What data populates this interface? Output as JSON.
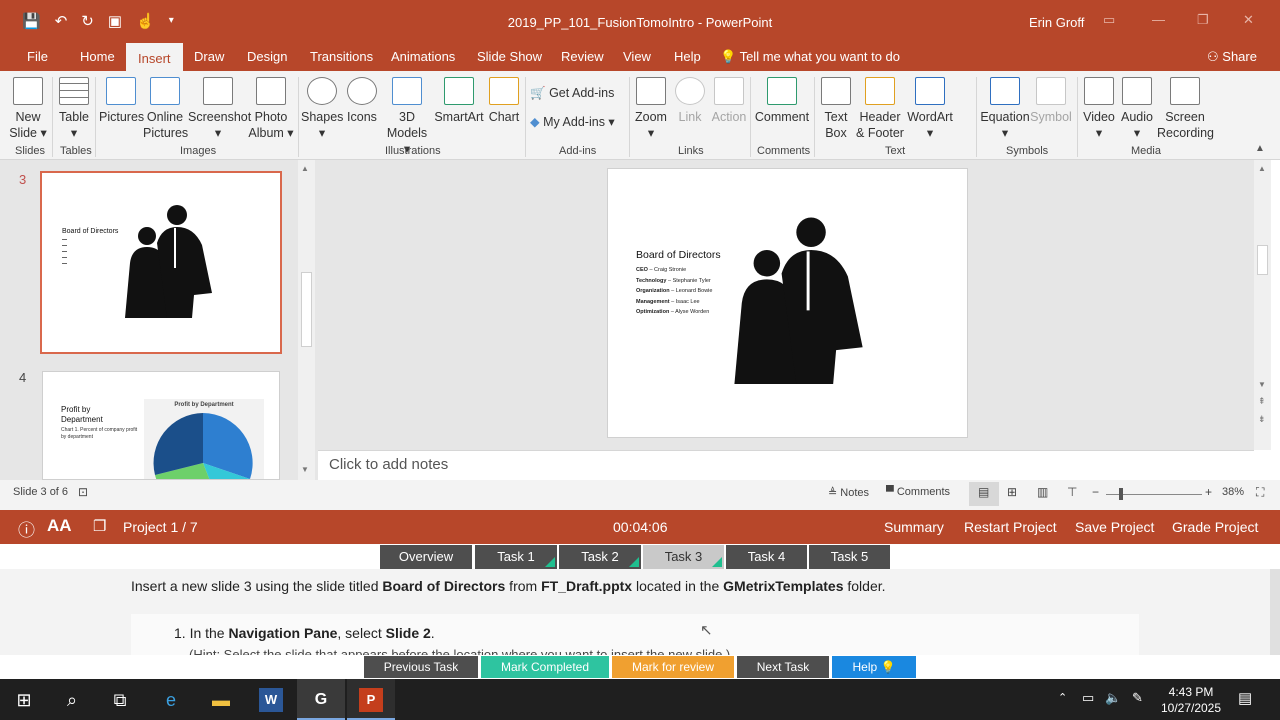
{
  "titlebar": {
    "document_title": "2019_PP_101_FusionTomoIntro - PowerPoint",
    "user": "Erin Groff",
    "qat_icons": [
      "save-icon",
      "undo-icon",
      "redo-icon",
      "present-icon",
      "touch-mode-icon",
      "customize-icon"
    ]
  },
  "tabs": [
    "File",
    "Home",
    "Insert",
    "Draw",
    "Design",
    "Transitions",
    "Animations",
    "Slide Show",
    "Review",
    "View",
    "Help"
  ],
  "active_tab": "Insert",
  "tell_me": "Tell me what you want to do",
  "share": "Share",
  "ribbon": {
    "new_slide": [
      "New",
      "Slide ▾"
    ],
    "table": [
      "Table",
      "▾"
    ],
    "pictures": "Pictures",
    "online_pictures": [
      "Online",
      "Pictures"
    ],
    "screenshot": [
      "Screenshot",
      "▾"
    ],
    "photo_album": [
      "Photo",
      "Album ▾"
    ],
    "shapes": [
      "Shapes",
      "▾"
    ],
    "icons": "Icons",
    "models": [
      "3D",
      "Models ▾"
    ],
    "smartart": "SmartArt",
    "chart": "Chart",
    "get_addins": "Get Add-ins",
    "my_addins": "My Add-ins",
    "zoom": [
      "Zoom",
      "▾"
    ],
    "link": "Link",
    "action": "Action",
    "comment": "Comment",
    "text_box": [
      "Text",
      "Box"
    ],
    "header_footer": [
      "Header",
      "& Footer"
    ],
    "wordart": [
      "WordArt",
      "▾"
    ],
    "equation": [
      "Equation",
      "▾"
    ],
    "symbol": "Symbol",
    "video": [
      "Video",
      "▾"
    ],
    "audio": [
      "Audio",
      "▾"
    ],
    "screen_recording": [
      "Screen",
      "Recording"
    ],
    "groups": [
      "Slides",
      "Tables",
      "Images",
      "Illustrations",
      "Add-ins",
      "Links",
      "Comments",
      "Text",
      "Symbols",
      "Media"
    ]
  },
  "thumbnails": [
    {
      "number": "3",
      "title": "Board of Directors"
    },
    {
      "number": "4",
      "title": "Profit by Department",
      "subtitle": "Chart 1. Percent of company profit by department",
      "chart_title": "Profit by Department"
    }
  ],
  "slide": {
    "title": "Board of Directors",
    "items": [
      {
        "role": "CEO",
        "name": "Craig Stronie"
      },
      {
        "role": "Technology",
        "name": "Stephanie Tyler"
      },
      {
        "role": "Organization",
        "name": "Leonard Bowie"
      },
      {
        "role": "Management",
        "name": "Isaac Lee"
      },
      {
        "role": "Optimization",
        "name": "Alyse Worden"
      }
    ]
  },
  "notes_placeholder": "Click to add notes",
  "status": {
    "slide_counter": "Slide 3 of 6",
    "notes": "Notes",
    "comments": "Comments",
    "zoom": "38%",
    "zoom_level": 0.38
  },
  "gmetrix": {
    "project": "Project 1 / 7",
    "timer": "00:04:06",
    "summary": "Summary",
    "restart": "Restart Project",
    "save": "Save Project",
    "grade": "Grade Project",
    "tasks": [
      "Overview",
      "Task 1",
      "Task 2",
      "Task 3",
      "Task 4",
      "Task 5"
    ],
    "active_task": "Task 3",
    "instruction": {
      "pre1": "Insert a new slide 3 using the slide titled ",
      "b1": "Board of Directors",
      "pre2": " from ",
      "b2": "FT_Draft.pptx",
      "pre3": " located in the ",
      "b3": "GMetrixTemplates",
      "post": " folder."
    },
    "step": {
      "num": "1. In the ",
      "b1": "Navigation Pane",
      "mid": ", select ",
      "b2": "Slide 2",
      "end": "."
    },
    "hint": "(Hint: Select the slide that appears before the location where you want to insert the new slide.)",
    "buttons": {
      "previous": "Previous Task",
      "complete": "Mark Completed",
      "review": "Mark for review",
      "next": "Next Task",
      "help": "Help"
    },
    "colors": {
      "complete": "#2ec4a0",
      "review": "#f0a030",
      "help": "#1a88e0",
      "dark": "#4e4e4e"
    }
  },
  "taskbar": {
    "time": "4:43 PM",
    "date": "10/27/2025"
  }
}
